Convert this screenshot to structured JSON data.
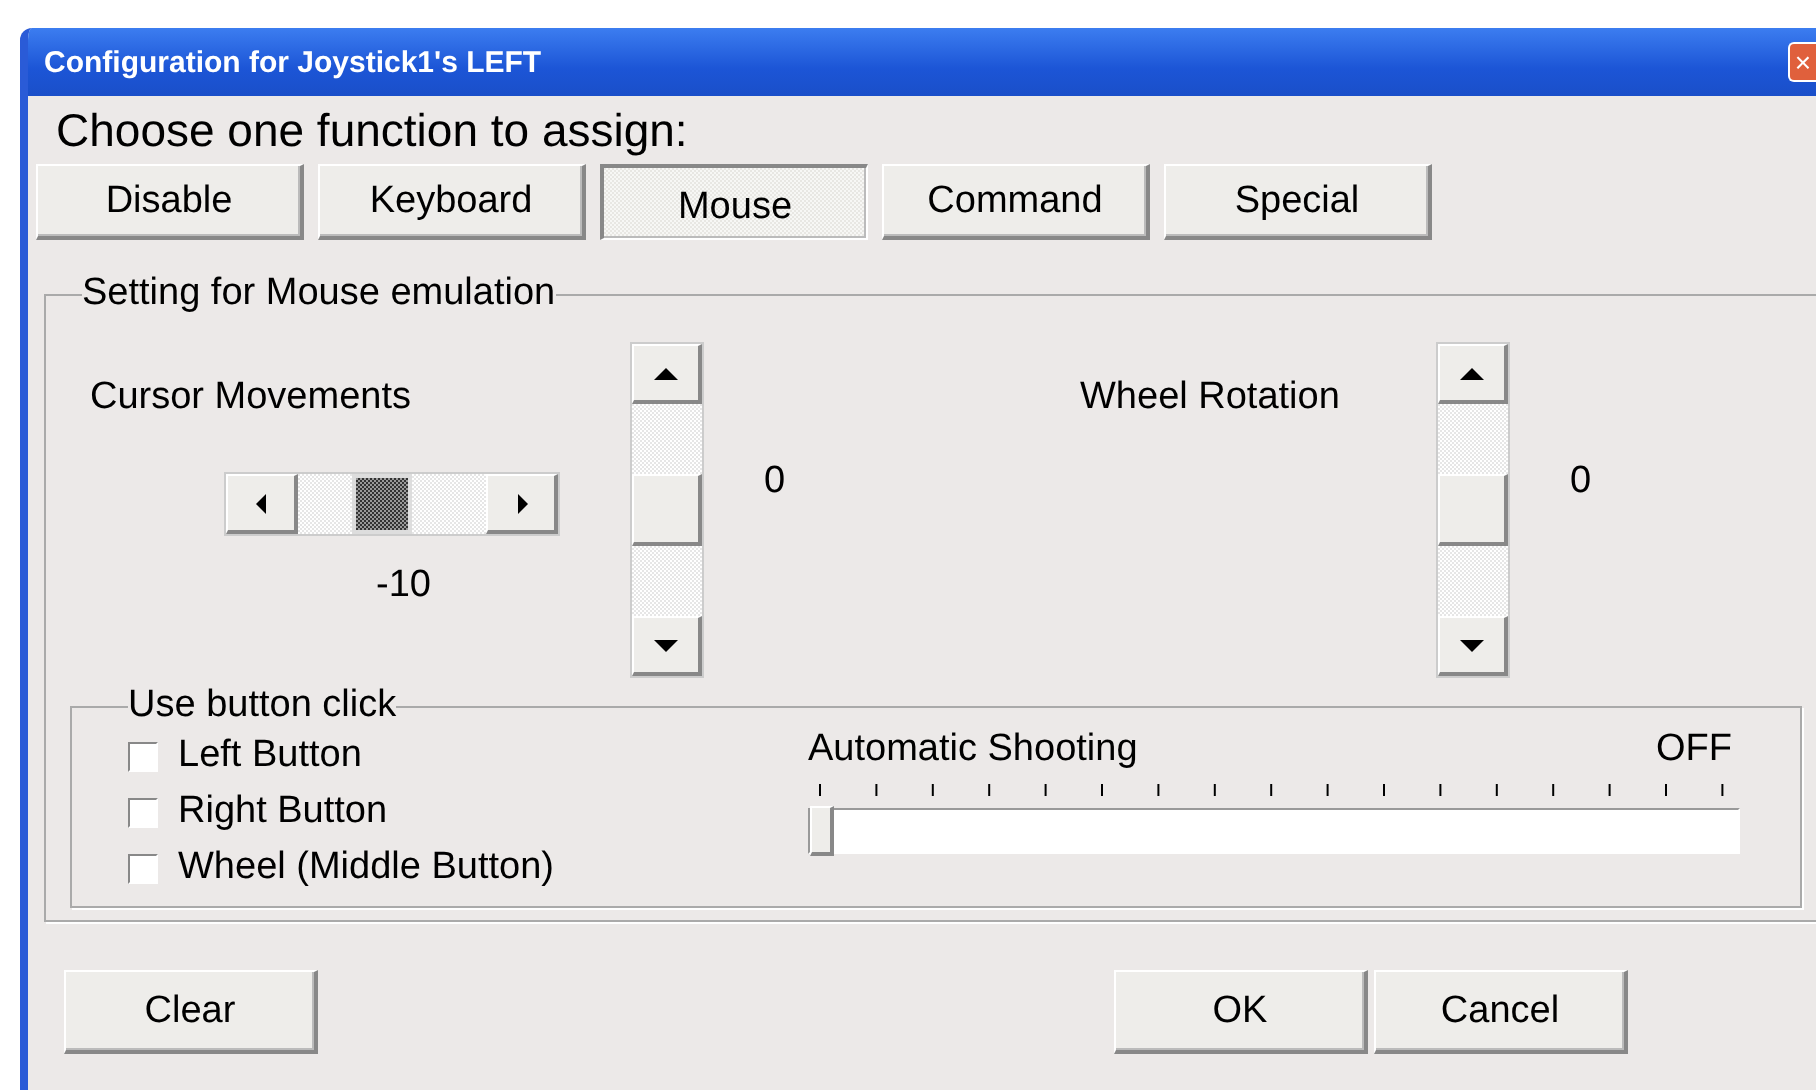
{
  "window": {
    "title": "Configuration for Joystick1's LEFT",
    "close": "×"
  },
  "heading": "Choose one function to assign:",
  "functions": [
    {
      "label": "Disable",
      "selected": false
    },
    {
      "label": "Keyboard",
      "selected": false
    },
    {
      "label": "Mouse",
      "selected": true
    },
    {
      "label": "Command",
      "selected": false
    },
    {
      "label": "Special",
      "selected": false
    }
  ],
  "mouse_group": {
    "title": "Setting for Mouse emulation",
    "cursor": {
      "label": "Cursor Movements",
      "horizontal": {
        "level": 0.45,
        "reading": "-10"
      },
      "vertical": {
        "level": 0.5,
        "reading": "0"
      }
    },
    "wheel": {
      "label": "Wheel Rotation",
      "vertical": {
        "level": 0.5,
        "reading": "0"
      }
    }
  },
  "click_group": {
    "title": "Use button click",
    "checkboxes": [
      {
        "label": "Left Button",
        "checked": false
      },
      {
        "label": "Right Button",
        "checked": false
      },
      {
        "label": "Wheel (Middle Button)",
        "checked": false
      }
    ],
    "shooting": {
      "label": "Automatic Shooting",
      "reading": "OFF",
      "level": 0
    }
  },
  "buttons": [
    {
      "label": "Clear",
      "kind": "left"
    },
    {
      "label": "OK",
      "kind": "right"
    },
    {
      "label": "Cancel",
      "kind": "right"
    }
  ]
}
